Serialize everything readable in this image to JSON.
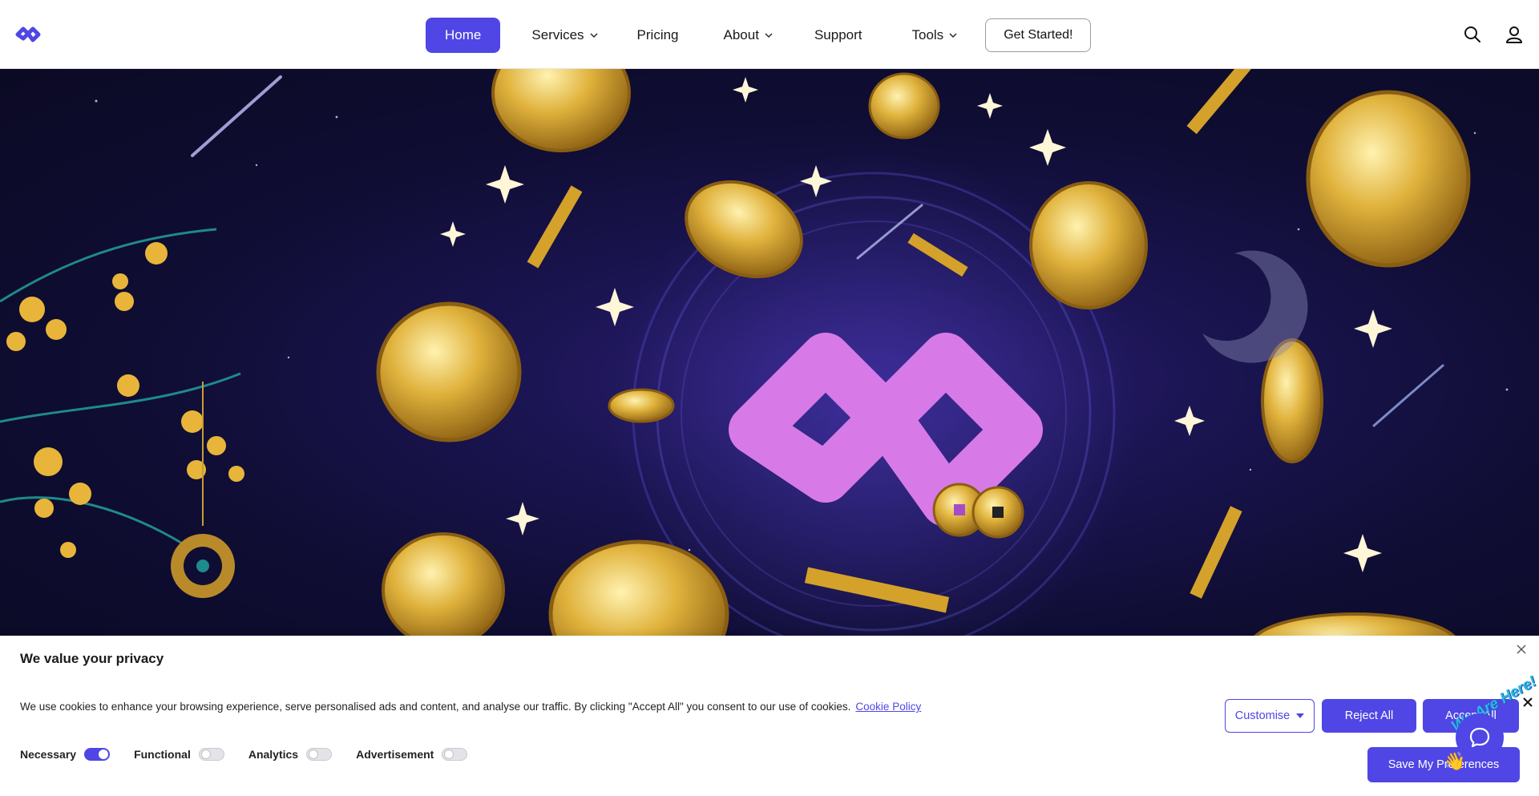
{
  "header": {
    "logo_icon": "brand-infinity-logo",
    "nav": [
      {
        "label": "Home",
        "active": true
      },
      {
        "label": "Services",
        "has_dropdown": true
      },
      {
        "label": "Pricing"
      },
      {
        "label": "About",
        "has_dropdown": true
      },
      {
        "label": "Support"
      },
      {
        "label": "Tools",
        "has_dropdown": true
      }
    ],
    "cta_label": "Get Started!",
    "icons": [
      "search-icon",
      "user-icon"
    ]
  },
  "hero": {
    "background_colors": [
      "#0b0a24",
      "#2d1f78"
    ],
    "logo_color": "#d77ae8",
    "coin_color": "#d4a12a"
  },
  "cookie_banner": {
    "title": "We value your privacy",
    "text": "We use cookies to enhance your browsing experience, serve personalised ads and content, and analyse our traffic. By clicking \"Accept All\" you consent to our use of cookies.",
    "link_label": "Cookie Policy",
    "toggles": [
      {
        "label": "Necessary",
        "on": true
      },
      {
        "label": "Functional",
        "on": false
      },
      {
        "label": "Analytics",
        "on": false
      },
      {
        "label": "Advertisement",
        "on": false
      }
    ],
    "customise_label": "Customise",
    "reject_label": "Reject All",
    "accept_label": "Accept All",
    "save_label": "Save My Preferences"
  },
  "chat_widget": {
    "banner_text": "We Are Here!",
    "icon": "chat-bubble-icon"
  },
  "colors": {
    "accent": "#4f46e5"
  }
}
